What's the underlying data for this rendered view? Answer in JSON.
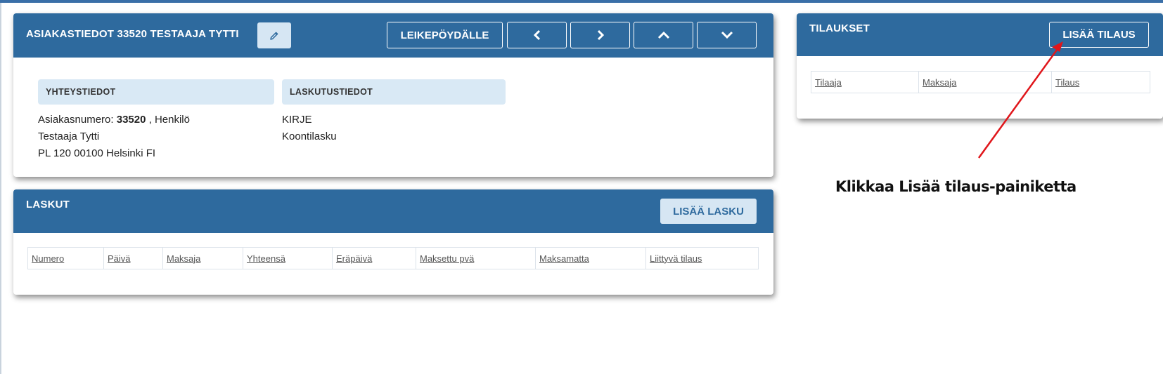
{
  "customer": {
    "title": "ASIAKASTIEDOT 33520 TESTAAJA TYTTI",
    "edit_icon": "pencil-icon",
    "clipboard_label": "LEIKEPÖYDÄLLE",
    "nav_icons": [
      "chevron-left-icon",
      "chevron-right-icon",
      "chevron-up-icon",
      "chevron-down-icon"
    ],
    "contact": {
      "heading": "YHTEYSTIEDOT",
      "number_prefix": "Asiakasnumero:",
      "number": "33520",
      "type_suffix": ", Henkilö",
      "name": "Testaaja Tytti",
      "address": "PL 120 00100 Helsinki FI"
    },
    "billing": {
      "heading": "LASKUTUSTIEDOT",
      "method": "KIRJE",
      "type": "Koontilasku"
    }
  },
  "invoices": {
    "title": "LASKUT",
    "add_label": "LISÄÄ LASKU",
    "columns": [
      "Numero",
      "Päivä",
      "Maksaja",
      "Yhteensä",
      "Eräpäivä",
      "Maksettu pvä",
      "Maksamatta",
      "Liittyvä tilaus"
    ]
  },
  "orders": {
    "title": "TILAUKSET",
    "add_label": "LISÄÄ TILAUS",
    "columns": [
      "Tilaaja",
      "Maksaja",
      "Tilaus"
    ]
  },
  "annotation": {
    "text": "Klikkaa Lisää tilaus-painiketta",
    "arrow_color": "#e0161b"
  },
  "colors": {
    "header_blue": "#2e6a9e",
    "light_blue": "#d9e9f5"
  }
}
